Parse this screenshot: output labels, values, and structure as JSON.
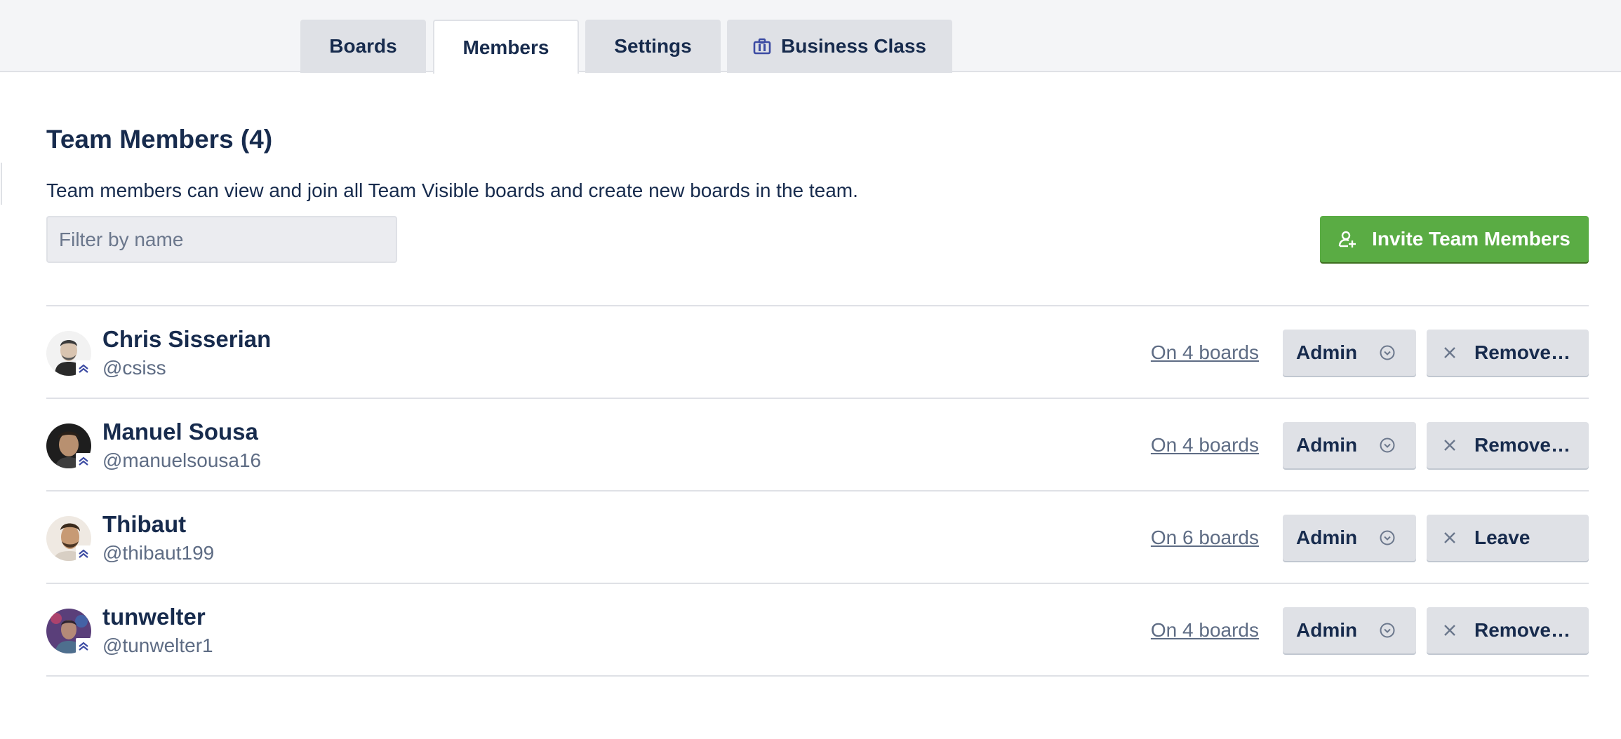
{
  "tabs": [
    {
      "label": "Boards",
      "active": false
    },
    {
      "label": "Members",
      "active": true
    },
    {
      "label": "Settings",
      "active": false
    },
    {
      "label": "Business Class",
      "active": false,
      "icon": "briefcase-icon"
    }
  ],
  "section": {
    "title": "Team Members (4)",
    "description": "Team members can view and join all Team Visible boards and create new boards in the team.",
    "filter_placeholder": "Filter by name",
    "filter_value": ""
  },
  "invite_button": {
    "label": "Invite Team Members",
    "icon": "add-member-icon"
  },
  "members": [
    {
      "name": "Chris Sisserian",
      "username": "@csiss",
      "boards": "On 4 boards",
      "role": "Admin",
      "action": "Remove…"
    },
    {
      "name": "Manuel Sousa",
      "username": "@manuelsousa16",
      "boards": "On 4 boards",
      "role": "Admin",
      "action": "Remove…"
    },
    {
      "name": "Thibaut",
      "username": "@thibaut199",
      "boards": "On 6 boards",
      "role": "Admin",
      "action": "Leave"
    },
    {
      "name": "tunwelter",
      "username": "@tunwelter1",
      "boards": "On 4 boards",
      "role": "Admin",
      "action": "Remove…"
    }
  ],
  "colors": {
    "accent_green": "#5aac44",
    "text_primary": "#172b4d",
    "text_muted": "#5e6c84",
    "button_gray": "#dfe1e6",
    "badge_blue": "#3c4ba3"
  }
}
